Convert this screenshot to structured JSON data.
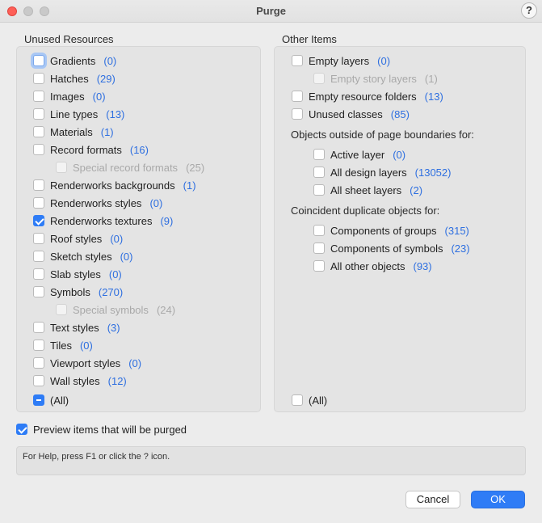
{
  "window": {
    "title": "Purge",
    "help_label": "?"
  },
  "unused": {
    "title": "Unused Resources",
    "items": [
      {
        "label": "Gradients",
        "count": "(0)",
        "checked": false,
        "disabled": false,
        "focused": true
      },
      {
        "label": "Hatches",
        "count": "(29)",
        "checked": false,
        "disabled": false
      },
      {
        "label": "Images",
        "count": "(0)",
        "checked": false,
        "disabled": false
      },
      {
        "label": "Line types",
        "count": "(13)",
        "checked": false,
        "disabled": false
      },
      {
        "label": "Materials",
        "count": "(1)",
        "checked": false,
        "disabled": false
      },
      {
        "label": "Record formats",
        "count": "(16)",
        "checked": false,
        "disabled": false
      },
      {
        "label": "Special record formats",
        "count": "(25)",
        "checked": false,
        "disabled": true
      },
      {
        "label": "Renderworks backgrounds",
        "count": "(1)",
        "checked": false,
        "disabled": false
      },
      {
        "label": "Renderworks styles",
        "count": "(0)",
        "checked": false,
        "disabled": false
      },
      {
        "label": "Renderworks textures",
        "count": "(9)",
        "checked": true,
        "disabled": false
      },
      {
        "label": "Roof styles",
        "count": "(0)",
        "checked": false,
        "disabled": false
      },
      {
        "label": "Sketch styles",
        "count": "(0)",
        "checked": false,
        "disabled": false
      },
      {
        "label": "Slab styles",
        "count": "(0)",
        "checked": false,
        "disabled": false
      },
      {
        "label": "Symbols",
        "count": "(270)",
        "checked": false,
        "disabled": false
      },
      {
        "label": "Special symbols",
        "count": "(24)",
        "checked": false,
        "disabled": true
      },
      {
        "label": "Text styles",
        "count": "(3)",
        "checked": false,
        "disabled": false
      },
      {
        "label": "Tiles",
        "count": "(0)",
        "checked": false,
        "disabled": false
      },
      {
        "label": "Viewport styles",
        "count": "(0)",
        "checked": false,
        "disabled": false
      },
      {
        "label": "Wall styles",
        "count": "(12)",
        "checked": false,
        "disabled": false
      }
    ],
    "all_label": "(All)",
    "all_state": "mixed"
  },
  "other": {
    "title": "Other Items",
    "items": [
      {
        "label": "Empty layers",
        "count": "(0)",
        "checked": false,
        "disabled": false
      },
      {
        "label": "Empty story layers",
        "count": "(1)",
        "checked": false,
        "disabled": true
      },
      {
        "label": "Empty resource folders",
        "count": "(13)",
        "checked": false,
        "disabled": false
      },
      {
        "label": "Unused classes",
        "count": "(85)",
        "checked": false,
        "disabled": false
      }
    ],
    "outside_heading": "Objects outside of page boundaries for:",
    "outside_items": [
      {
        "label": "Active layer",
        "count": "(0)",
        "checked": false
      },
      {
        "label": "All design layers",
        "count": "(13052)",
        "checked": false
      },
      {
        "label": "All sheet layers",
        "count": "(2)",
        "checked": false
      }
    ],
    "dup_heading": "Coincident duplicate objects for:",
    "dup_items": [
      {
        "label": "Components of groups",
        "count": "(315)",
        "checked": false
      },
      {
        "label": "Components of symbols",
        "count": "(23)",
        "checked": false
      },
      {
        "label": "All other objects",
        "count": "(93)",
        "checked": false
      }
    ],
    "all_label": "(All)",
    "all_state": "unchecked"
  },
  "preview": {
    "label": "Preview items that will be purged",
    "checked": true
  },
  "status_text": "For Help, press F1 or click the ? icon.",
  "buttons": {
    "cancel": "Cancel",
    "ok": "OK"
  },
  "colors": {
    "accent": "#2e7cf6",
    "count_text": "#2e6fe0",
    "close": "#fe5f57"
  }
}
